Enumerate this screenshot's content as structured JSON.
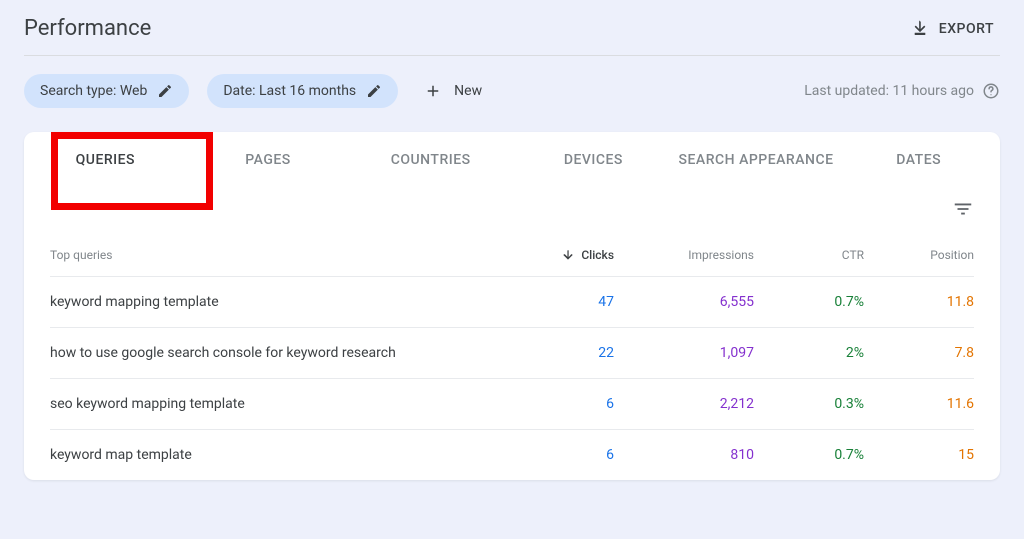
{
  "header": {
    "title": "Performance",
    "export_label": "EXPORT"
  },
  "filters": {
    "search_type_chip": "Search type: Web",
    "date_chip": "Date: Last 16 months",
    "new_label": "New",
    "last_updated": "Last updated: 11 hours ago"
  },
  "tabs": {
    "queries": "QUERIES",
    "pages": "PAGES",
    "countries": "COUNTRIES",
    "devices": "DEVICES",
    "search_appearance": "SEARCH APPEARANCE",
    "dates": "DATES"
  },
  "table": {
    "headers": {
      "queries": "Top queries",
      "clicks": "Clicks",
      "impressions": "Impressions",
      "ctr": "CTR",
      "position": "Position"
    },
    "rows": [
      {
        "query": "keyword mapping template",
        "clicks": "47",
        "impressions": "6,555",
        "ctr": "0.7%",
        "position": "11.8"
      },
      {
        "query": "how to use google search console for keyword research",
        "clicks": "22",
        "impressions": "1,097",
        "ctr": "2%",
        "position": "7.8"
      },
      {
        "query": "seo keyword mapping template",
        "clicks": "6",
        "impressions": "2,212",
        "ctr": "0.3%",
        "position": "11.6"
      },
      {
        "query": "keyword map template",
        "clicks": "6",
        "impressions": "810",
        "ctr": "0.7%",
        "position": "15"
      }
    ]
  }
}
